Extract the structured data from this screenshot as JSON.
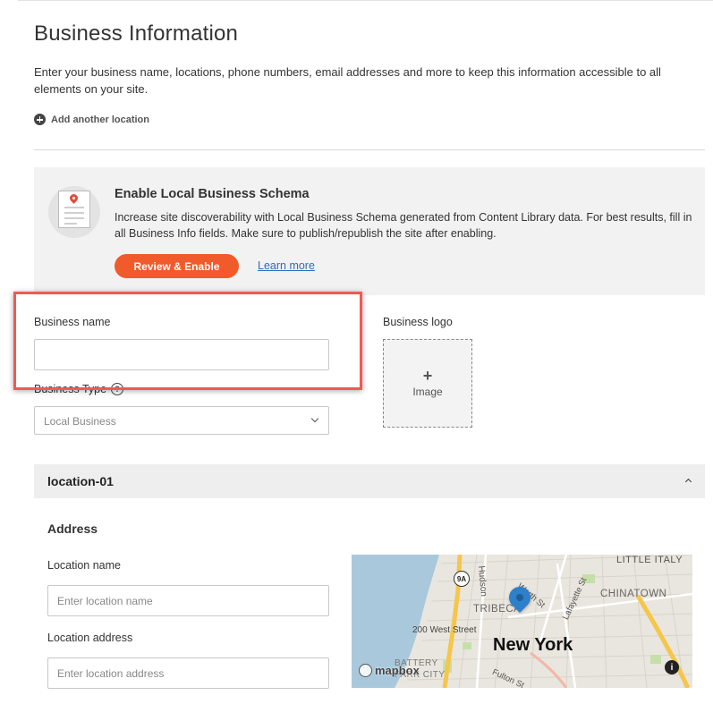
{
  "page": {
    "title": "Business Information",
    "description": "Enter your business name, locations, phone numbers, email addresses and more to keep this information accessible to all elements on your site.",
    "add_location_label": "Add another location"
  },
  "schema": {
    "title": "Enable Local Business Schema",
    "description": "Increase site discoverability with Local Business Schema generated from Content Library data. For best results, fill in all Business Info fields. Make sure to publish/republish the site after enabling.",
    "review_button": "Review & Enable",
    "learn_more": "Learn more"
  },
  "form": {
    "business_name_label": "Business name",
    "business_name_value": "",
    "business_type_label": "Business Type",
    "business_type_value": "Local Business",
    "business_logo_label": "Business logo",
    "logo_plus": "+",
    "logo_image_label": "Image"
  },
  "location": {
    "header": "location-01",
    "address_heading": "Address",
    "location_name_label": "Location name",
    "location_name_placeholder": "Enter location name",
    "location_address_label": "Location address",
    "location_address_placeholder": "Enter location address"
  },
  "map": {
    "city": "New York",
    "labels": {
      "tribeca": "TRIBECA",
      "chinatown": "CHINATOWN",
      "little_italy": "LITTLE ITALY",
      "west_street": "200 West Street",
      "battery": "BATTERY",
      "park_city": "PARK CITY",
      "route": "9A",
      "worth": "Worth St",
      "lafayette": "Lafayette St",
      "fulton": "Fulton St",
      "hudson": "Hudson",
      "mapbox": "mapbox",
      "info": "i"
    },
    "colors": {
      "water": "#a9c8dc",
      "land": "#e9e6df",
      "highway": "#f5c64a",
      "park": "#c5dfa8",
      "pin": "#2d80c9"
    }
  }
}
